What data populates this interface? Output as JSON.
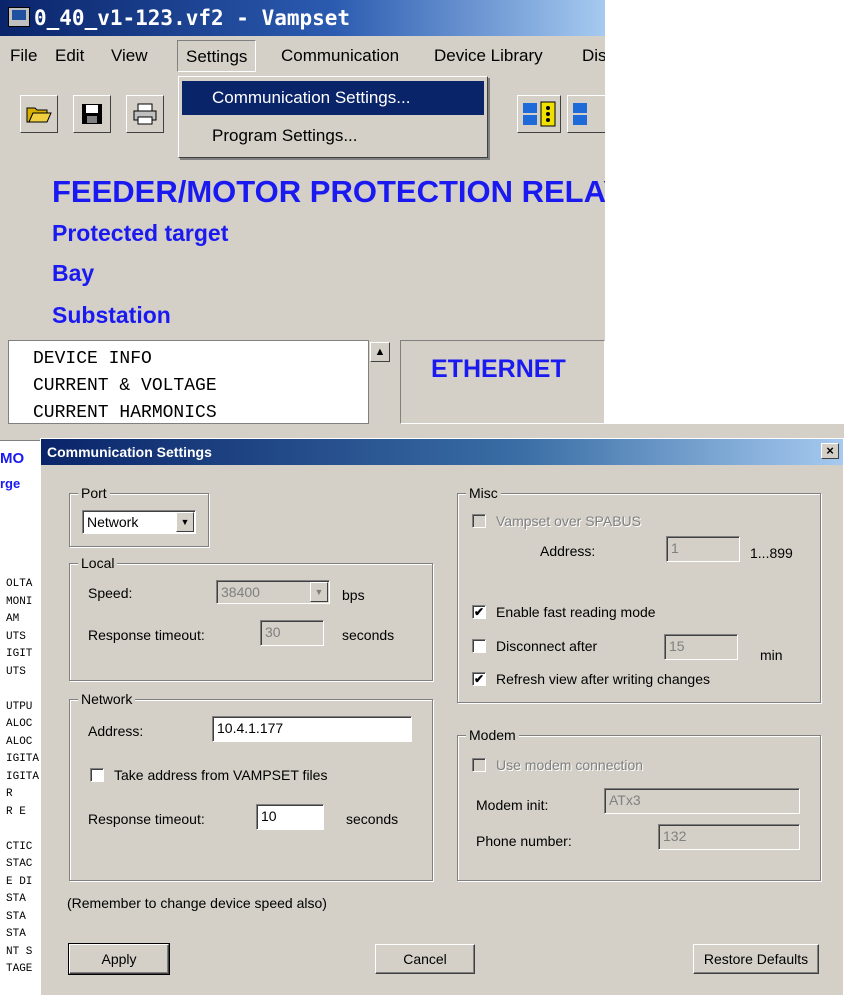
{
  "app": {
    "title": "0_40_v1-123.vf2 - Vampset",
    "menu": [
      "File",
      "Edit",
      "View",
      "Settings",
      "Communication",
      "Device Library",
      "Dis"
    ],
    "settings_menu_items": [
      "Communication Settings...",
      "Program Settings..."
    ],
    "header": {
      "title": "FEEDER/MOTOR PROTECTION RELAY",
      "protected_target": "Protected target",
      "bay": "Bay",
      "substation": "Substation"
    },
    "nav_list": [
      "DEVICE INFO",
      "CURRENT & VOLTAGE",
      "CURRENT HARMONICS"
    ],
    "panel_title": "ETHERNET"
  },
  "background": {
    "left_heading_1": "MO",
    "left_heading_2": "rge",
    "left_rows": [
      "OLTA",
      "MONI",
      "AM",
      "UTS",
      "IGIT",
      "UTS",
      "",
      "UTPU",
      "ALOC",
      "ALOC",
      "IGITA",
      "IGITA",
      "R",
      "R E",
      "",
      "CTIC",
      "STAC",
      "E DI",
      "STA",
      "STA",
      "STA",
      "NT S",
      "TAGE"
    ]
  },
  "dialog": {
    "title": "Communication Settings",
    "close": "×",
    "port": {
      "legend": "Port",
      "value": "Network"
    },
    "local": {
      "legend": "Local",
      "speed_label": "Speed:",
      "speed_value": "38400",
      "speed_unit": "bps",
      "timeout_label": "Response timeout:",
      "timeout_value": "30",
      "timeout_unit": "seconds"
    },
    "network": {
      "legend": "Network",
      "address_label": "Address:",
      "address_value": "10.4.1.177",
      "take_address_label": "Take address from VAMPSET files",
      "take_address_checked": false,
      "timeout_label": "Response timeout:",
      "timeout_value": "10",
      "timeout_unit": "seconds"
    },
    "note": "(Remember to change device speed also)",
    "misc": {
      "legend": "Misc",
      "spabus_label": "Vampset over SPABUS",
      "address_label": "Address:",
      "address_value": "1",
      "address_range": "1...899",
      "fast_read_label": "Enable fast reading mode",
      "fast_read_checked": true,
      "disconnect_label": "Disconnect after",
      "disconnect_value": "15",
      "disconnect_unit": "min",
      "disconnect_checked": false,
      "refresh_label": "Refresh view after writing changes",
      "refresh_checked": true
    },
    "modem": {
      "legend": "Modem",
      "use_modem_label": "Use modem connection",
      "init_label": "Modem init:",
      "init_value": "ATx3",
      "phone_label": "Phone number:",
      "phone_value": "132"
    },
    "buttons": {
      "apply": "Apply",
      "cancel": "Cancel",
      "restore": "Restore Defaults"
    }
  },
  "icons": {
    "open": "folder-open-icon",
    "save": "floppy-disk-icon",
    "print": "printer-icon",
    "checkmark": "✔",
    "dropdown": "▼",
    "scroll_up": "▲"
  },
  "colors": {
    "header_text": "#1a1af0",
    "title_bar": "#0a246a",
    "dialog_bg": "#d4d0c8"
  }
}
